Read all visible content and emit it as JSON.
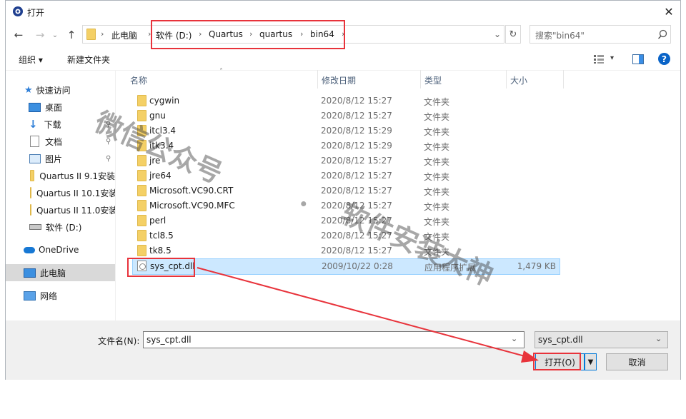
{
  "title": "打开",
  "address": {
    "crumbs": [
      "此电脑",
      "软件 (D:)",
      "Quartus",
      "quartus",
      "bin64"
    ],
    "sep": "›"
  },
  "search": {
    "placeholder": "搜索\"bin64\""
  },
  "commands": {
    "organize": "组织 ▾",
    "new_folder": "新建文件夹"
  },
  "nav": {
    "quick_access": "快速访问",
    "desktop": "桌面",
    "downloads": "下载",
    "documents": "文档",
    "pictures": "图片",
    "q91": "Quartus II 9.1安装",
    "q101": "Quartus II 10.1安装",
    "q110": "Quartus II 11.0安装",
    "drive_d": "软件 (D:)",
    "onedrive": "OneDrive",
    "this_pc": "此电脑",
    "network": "网络"
  },
  "columns": {
    "name": "名称",
    "date": "修改日期",
    "type": "类型",
    "size": "大小"
  },
  "files": [
    {
      "name": "cygwin",
      "date": "2020/8/12 15:27",
      "type": "文件夹",
      "size": ""
    },
    {
      "name": "gnu",
      "date": "2020/8/12 15:27",
      "type": "文件夹",
      "size": ""
    },
    {
      "name": "itcl3.4",
      "date": "2020/8/12 15:29",
      "type": "文件夹",
      "size": ""
    },
    {
      "name": "itk3.4",
      "date": "2020/8/12 15:29",
      "type": "文件夹",
      "size": ""
    },
    {
      "name": "jre",
      "date": "2020/8/12 15:27",
      "type": "文件夹",
      "size": ""
    },
    {
      "name": "jre64",
      "date": "2020/8/12 15:27",
      "type": "文件夹",
      "size": ""
    },
    {
      "name": "Microsoft.VC90.CRT",
      "date": "2020/8/12 15:27",
      "type": "文件夹",
      "size": ""
    },
    {
      "name": "Microsoft.VC90.MFC",
      "date": "2020/8/12 15:27",
      "type": "文件夹",
      "size": ""
    },
    {
      "name": "perl",
      "date": "2020/8/12 15:27",
      "type": "文件夹",
      "size": ""
    },
    {
      "name": "tcl8.5",
      "date": "2020/8/12 15:27",
      "type": "文件夹",
      "size": ""
    },
    {
      "name": "tk8.5",
      "date": "2020/8/12 15:27",
      "type": "文件夹",
      "size": ""
    },
    {
      "name": "sys_cpt.dll",
      "date": "2009/10/22 0:28",
      "type": "应用程序扩展",
      "size": "1,479 KB",
      "selected": true
    }
  ],
  "bottom": {
    "filename_label": "文件名(N):",
    "filename_value": "sys_cpt.dll",
    "filter_value": "sys_cpt.dll",
    "open_label": "打开(O)",
    "cancel_label": "取消"
  },
  "watermark": [
    "微信公众号",
    "·",
    "软件安装大神"
  ],
  "colors": {
    "highlight": "#e8333b",
    "selection": "#cce8ff",
    "accent": "#0a64c8"
  }
}
